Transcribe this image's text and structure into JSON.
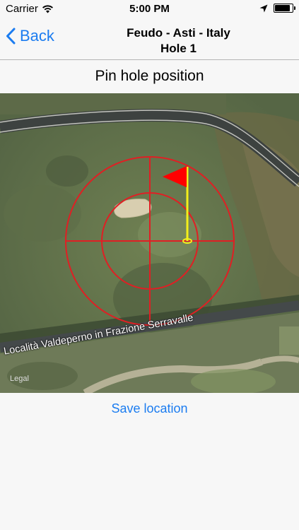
{
  "status_bar": {
    "carrier": "Carrier",
    "time": "5:00 PM",
    "wifi_icon": "wifi-icon",
    "location_icon": "location-arrow-icon",
    "battery_level": 0.95
  },
  "nav": {
    "back_label": "Back",
    "back_icon": "chevron-left-icon",
    "title_line1": "Feudo - Asti - Italy",
    "title_line2": "Hole 1"
  },
  "header": {
    "title": "Pin hole position"
  },
  "map": {
    "road_label": "Località Valdeperno in Frazione Serravalle",
    "legal_label": "Legal",
    "reticle_color": "#e01f24",
    "flag_color": "#ff0000",
    "pole_color": "#f4ef1a"
  },
  "actions": {
    "save_label": "Save location",
    "accent_color": "#1b7cf0"
  }
}
